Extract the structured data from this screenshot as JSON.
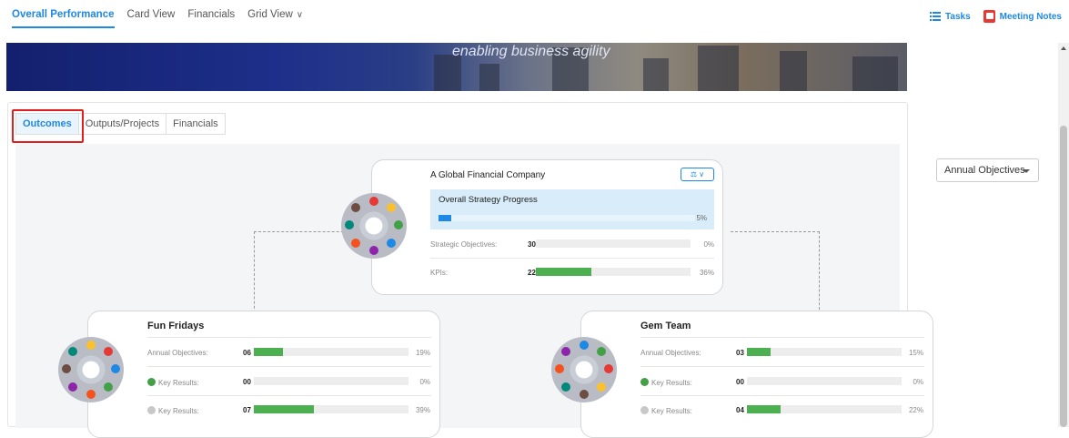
{
  "topnav": {
    "tabs": [
      {
        "label": "Overall Performance",
        "active": true
      },
      {
        "label": "Card View",
        "active": false
      },
      {
        "label": "Financials",
        "active": false
      },
      {
        "label": "Grid View",
        "active": false
      }
    ],
    "tasks_label": "Tasks",
    "meeting_notes_label": "Meeting Notes"
  },
  "banner": {
    "tagline": "enabling business agility"
  },
  "subtabs": [
    {
      "label": "Outcomes",
      "active": true
    },
    {
      "label": "Outputs/Projects",
      "active": false
    },
    {
      "label": "Financials",
      "active": false
    }
  ],
  "filter": {
    "selected": "Annual Objectives"
  },
  "root_card": {
    "title": "A Global Financial Company",
    "progress_title": "Overall Strategy Progress",
    "progress_pct": "5%",
    "progress_value": 0.05,
    "rows": [
      {
        "label": "Strategic Objectives:",
        "count": "30",
        "pct": "0%",
        "value": 0.0
      },
      {
        "label": "KPIs:",
        "count": "22",
        "pct": "36%",
        "value": 0.36
      }
    ]
  },
  "child_cards": [
    {
      "title": "Fun Fridays",
      "rows": [
        {
          "label": "Annual Objectives:",
          "count": "06",
          "pct": "19%",
          "value": 0.19,
          "icon": ""
        },
        {
          "label": "Key Results:",
          "count": "00",
          "pct": "0%",
          "value": 0.0,
          "icon": "green-check"
        },
        {
          "label": "Key Results:",
          "count": "07",
          "pct": "39%",
          "value": 0.39,
          "icon": "gray-check"
        }
      ]
    },
    {
      "title": "Gem Team",
      "rows": [
        {
          "label": "Annual Objectives:",
          "count": "03",
          "pct": "15%",
          "value": 0.15,
          "icon": ""
        },
        {
          "label": "Key Results:",
          "count": "00",
          "pct": "0%",
          "value": 0.0,
          "icon": "green-check"
        },
        {
          "label": "Key Results:",
          "count": "04",
          "pct": "22%",
          "value": 0.22,
          "icon": "gray-check"
        }
      ]
    }
  ],
  "colors": {
    "accent": "#1e88e5",
    "progress_green": "#4caf50",
    "highlight_red": "#e02020"
  }
}
